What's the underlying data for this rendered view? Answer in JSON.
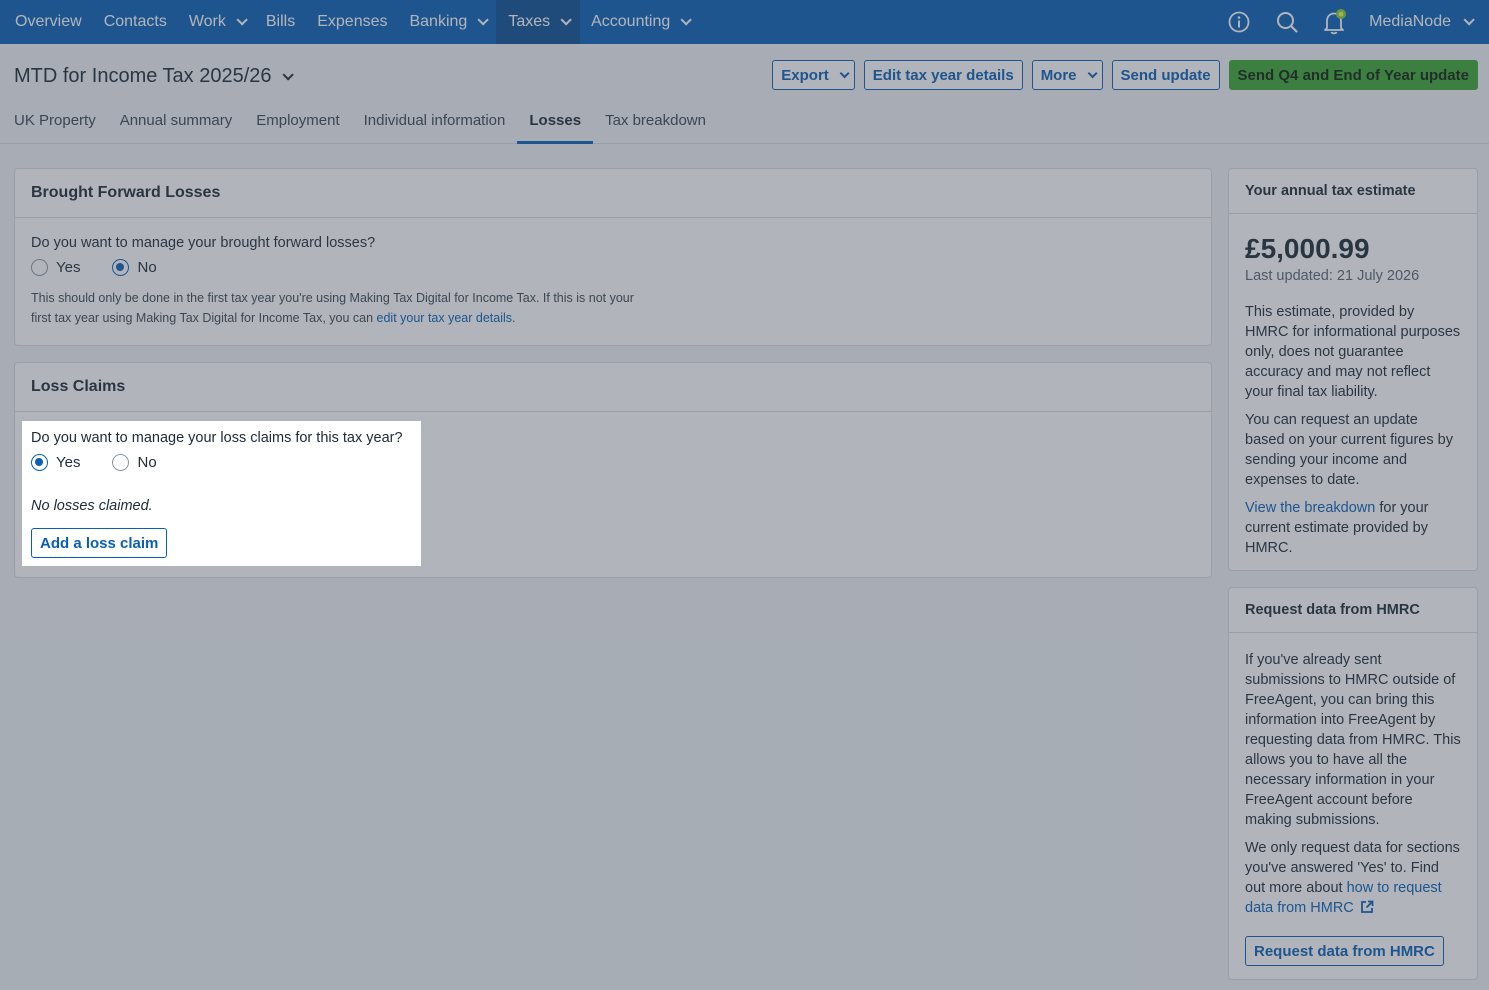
{
  "nav": {
    "items": [
      {
        "label": "Overview",
        "dropdown": false,
        "active": false
      },
      {
        "label": "Contacts",
        "dropdown": false,
        "active": false
      },
      {
        "label": "Work",
        "dropdown": true,
        "active": false
      },
      {
        "label": "Bills",
        "dropdown": false,
        "active": false
      },
      {
        "label": "Expenses",
        "dropdown": false,
        "active": false
      },
      {
        "label": "Banking",
        "dropdown": true,
        "active": false
      },
      {
        "label": "Taxes",
        "dropdown": true,
        "active": true
      },
      {
        "label": "Accounting",
        "dropdown": true,
        "active": false
      }
    ],
    "icons": [
      "info-icon",
      "search-icon",
      "bell-icon"
    ],
    "user": "MediaNode",
    "accent": "#0a5fb4"
  },
  "header": {
    "title": "MTD for Income Tax 2025/26",
    "actions": {
      "export": "Export",
      "edit": "Edit tax year details",
      "more": "More",
      "send_update": "Send update",
      "send_q4": "Send Q4 and End of Year update"
    },
    "tabs": [
      {
        "label": "UK Property",
        "active": false
      },
      {
        "label": "Annual summary",
        "active": false
      },
      {
        "label": "Employment",
        "active": false
      },
      {
        "label": "Individual information",
        "active": false
      },
      {
        "label": "Losses",
        "active": true
      },
      {
        "label": "Tax breakdown",
        "active": false
      }
    ]
  },
  "brought_forward": {
    "title": "Brought Forward Losses",
    "question": "Do you want to manage your brought forward losses?",
    "yes_label": "Yes",
    "no_label": "No",
    "selected": "No",
    "help_prefix": "This should only be done in the first tax year you're using Making Tax Digital for Income Tax. If this is not your first tax year using Making Tax Digital for Income Tax, you can ",
    "help_link": "edit your tax year details",
    "help_suffix": "."
  },
  "loss_claims": {
    "title": "Loss Claims",
    "question": "Do you want to manage your loss claims for this tax year?",
    "yes_label": "Yes",
    "no_label": "No",
    "selected": "Yes",
    "empty": "No losses claimed.",
    "add_button": "Add a loss claim"
  },
  "estimate": {
    "title": "Your annual tax estimate",
    "amount": "£5,000.99",
    "updated": "Last updated: 21 July 2026",
    "para1": "This estimate, provided by HMRC for informational purposes only, does not guarantee accuracy and may not reflect your final tax liability.",
    "para2": "You can request an update based on your current figures by sending your income and expenses to date.",
    "link": "View the breakdown",
    "para3_suffix": " for your current estimate provided by HMRC."
  },
  "hmrc": {
    "title": "Request data from HMRC",
    "para1": "If you've already sent submissions to HMRC outside of FreeAgent, you can bring this information into FreeAgent by requesting data from HMRC. This allows you to have all the necessary information in your FreeAgent account before making submissions.",
    "para2_prefix": "We only request data for sections you've answered 'Yes' to. Find out more about ",
    "link": "how to request data from HMRC",
    "button": "Request data from HMRC"
  }
}
